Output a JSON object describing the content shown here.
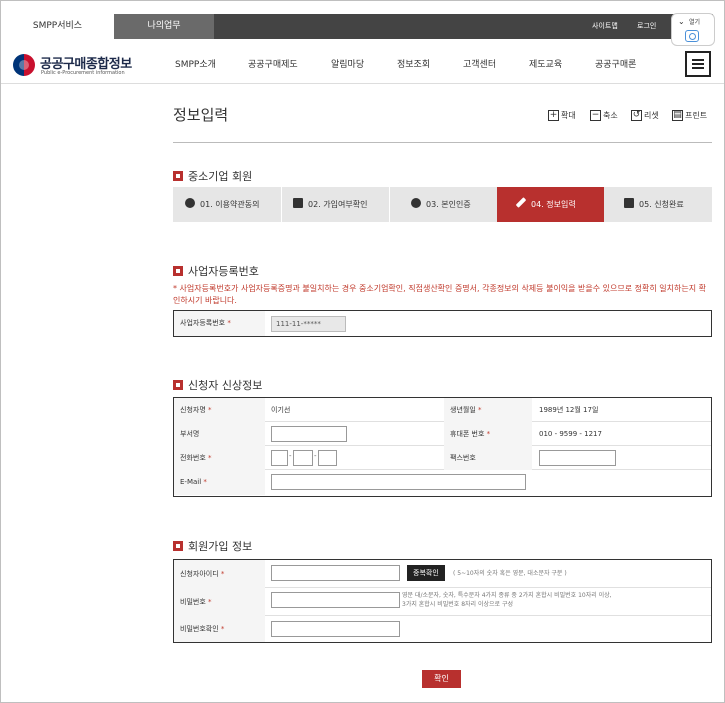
{
  "topbar": {
    "smpp_tab": "SMPP서비스",
    "mywork_tab": "나의업무",
    "sitemap": "사이트맵",
    "login": "로그인",
    "open": "열기"
  },
  "logo": {
    "title": "공공구매종합정보",
    "subtitle": "Public e-Procurement information"
  },
  "nav": [
    "SMPP소개",
    "공공구매제도",
    "알림마당",
    "정보조회",
    "고객센터",
    "제도교육",
    "공공구매론"
  ],
  "page": {
    "title": "정보입력",
    "tools": [
      "확대",
      "축소",
      "리셋",
      "프린트"
    ]
  },
  "section_member": {
    "heading": "중소기업 회원",
    "steps": [
      "01. 이용약관동의",
      "02. 가입여부확인",
      "03. 본인인증",
      "04. 정보입력",
      "05. 신청완료"
    ],
    "active_step": 3
  },
  "section_bizno": {
    "heading": "사업자등록번호",
    "warning": "* 사업자등록번호가 사업자등록증명과 불일치하는 경우 중소기업확인, 직접생산확인 증명서, 각종정보의 삭제등 불이익을 받을수 있으므로 정확히 일치하는지 확인하시기 바랍니다.",
    "label": "사업자등록번호",
    "value": "111-11-*****"
  },
  "section_applicant": {
    "heading": "신청자 신상정보",
    "name_label": "신청자명",
    "name_value": "이기선",
    "birth_label": "생년월일",
    "birth_value": "1989년 12월 17일",
    "dept_label": "부서명",
    "mobile_label": "휴대폰 번호",
    "mobile_value": "010 - 9599 - 1217",
    "phone_label": "전화번호",
    "fax_label": "팩스번호",
    "email_label": "E-Mail",
    "required_mark": "*",
    "dash": "-"
  },
  "section_account": {
    "heading": "회원가입 정보",
    "id_label": "신청자아이디",
    "dup_button": "중복확인",
    "id_hint": "( 5~10자의 숫자 혹은 영문, 대소문자 구분 )",
    "pw_label": "비밀번호",
    "pw_hint_1": "영문 대/소문자, 숫자, 특수문자 4가지 종류 중 2가지 혼합시 비밀번호 10자리 이상,",
    "pw_hint_2": "3가지 혼합시 비밀번호 8자리 이상으로 구성",
    "pw_confirm_label": "비밀번호확인"
  },
  "confirm_button": "확인",
  "colors": {
    "accent": "#b8302e",
    "topbar": "#444444"
  }
}
